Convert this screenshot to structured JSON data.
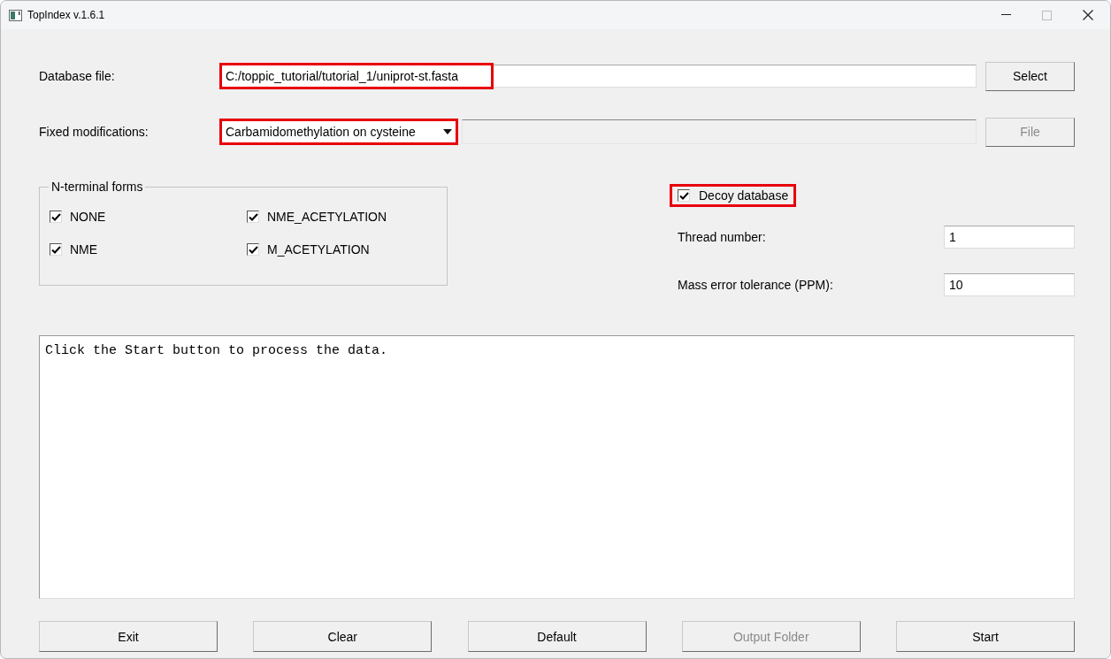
{
  "window": {
    "title": "TopIndex v.1.6.1"
  },
  "database_file": {
    "label": "Database file:",
    "value": "C:/toppic_tutorial/tutorial_1/uniprot-st.fasta",
    "highlighted": true
  },
  "select_button": {
    "label": "Select",
    "disabled": false
  },
  "fixed_modifications": {
    "label": "Fixed modifications:",
    "value": "Carbamidomethylation on cysteine",
    "highlighted": true
  },
  "file_field": {
    "disabled": true
  },
  "file_button": {
    "label": "File",
    "disabled": true
  },
  "n_terminal_forms": {
    "title": "N-terminal forms",
    "options": [
      {
        "label": "NONE",
        "checked": true
      },
      {
        "label": "NME_ACETYLATION",
        "checked": true
      },
      {
        "label": "NME",
        "checked": true
      },
      {
        "label": "M_ACETYLATION",
        "checked": true
      }
    ]
  },
  "decoy_database": {
    "label": "Decoy database",
    "checked": true,
    "highlighted": true
  },
  "thread_number": {
    "label": "Thread number:",
    "value": "1"
  },
  "mass_error_tolerance": {
    "label": "Mass error tolerance (PPM):",
    "value": "10"
  },
  "log": {
    "text": "Click the Start button to process the data."
  },
  "buttons": [
    {
      "label": "Exit",
      "disabled": false
    },
    {
      "label": "Clear",
      "disabled": false
    },
    {
      "label": "Default",
      "disabled": false
    },
    {
      "label": "Output Folder",
      "disabled": true
    },
    {
      "label": "Start",
      "disabled": false
    }
  ]
}
